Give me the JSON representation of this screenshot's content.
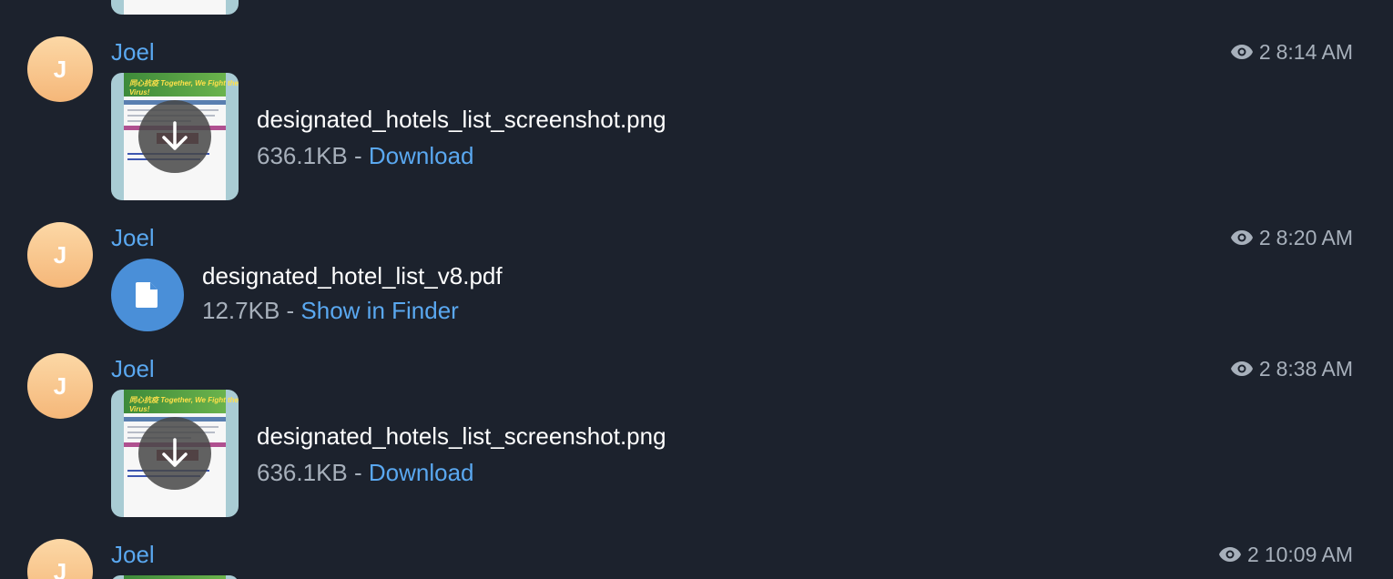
{
  "messages": [
    {
      "sender": "Joel",
      "avatar_initial": "J",
      "views": "2",
      "time": "8:14 AM",
      "type": "image",
      "file_name": "designated_hotels_list_screenshot.png",
      "file_size": "636.1KB",
      "separator": " - ",
      "action": "Download"
    },
    {
      "sender": "Joel",
      "avatar_initial": "J",
      "views": "2",
      "time": "8:20 AM",
      "type": "document",
      "file_name": "designated_hotel_list_v8.pdf",
      "file_size": "12.7KB",
      "separator": " - ",
      "action": "Show in Finder"
    },
    {
      "sender": "Joel",
      "avatar_initial": "J",
      "views": "2",
      "time": "8:38 AM",
      "type": "image",
      "file_name": "designated_hotels_list_screenshot.png",
      "file_size": "636.1KB",
      "separator": " - ",
      "action": "Download"
    },
    {
      "sender": "Joel",
      "avatar_initial": "J",
      "views": "2",
      "time": "10:09 AM",
      "type": "image"
    }
  ],
  "thumbnail_banner_text": "同心抗疫 Together, We Fight the Virus!",
  "icons": {
    "views": "eye-icon",
    "download": "arrow-down-icon",
    "document": "document-icon"
  },
  "colors": {
    "background": "#1c222d",
    "accent": "#5aa8f0",
    "muted": "#a7b0bb",
    "doc_circle": "#4a8fd8"
  }
}
